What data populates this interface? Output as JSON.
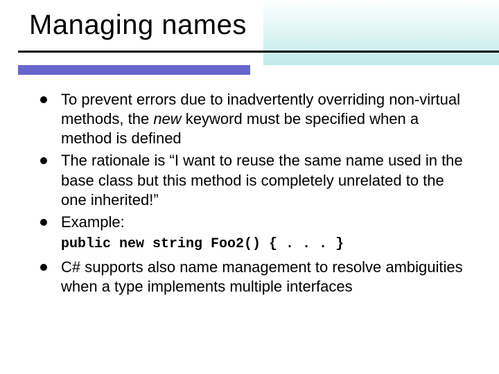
{
  "title": "Managing names",
  "bullets": [
    {
      "pre": "To prevent errors due to inadvertently overriding non-virtual methods, the ",
      "em": "new",
      "post": " keyword must be specified when a method is defined"
    },
    {
      "text": "The rationale is “I want to reuse the same name used in the base class but this method is completely unrelated to the one inherited!”"
    },
    {
      "text": "Example:"
    }
  ],
  "code": "public new string Foo2() { . . . }",
  "bullet_after_code": {
    "text": "C# supports also name management to resolve ambiguities when a type implements multiple interfaces"
  }
}
